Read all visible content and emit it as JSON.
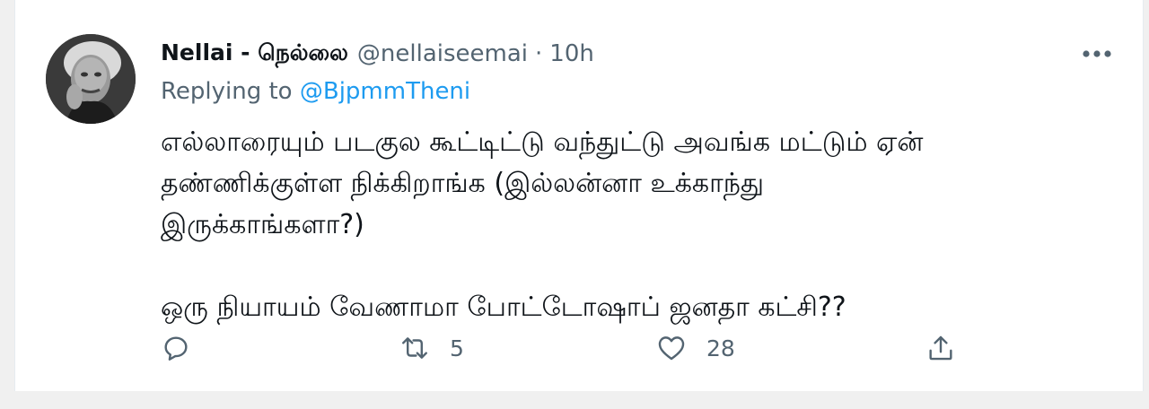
{
  "tweet": {
    "display_name": "Nellai - நெல்லை",
    "handle": "@nellaiseemai",
    "separator": "·",
    "time": "10h",
    "replying_prefix": "Replying to",
    "replying_to": "@BjpmmTheni",
    "text_line_1": "எல்லாரையும் படகுல கூட்டிட்டு வந்துட்டு அவங்க மட்டும் ஏன்",
    "text_line_2": "தண்ணிக்குள்ள நிக்கிறாங்க (இல்லன்னா உக்காந்து",
    "text_line_3": "இருக்காங்களா?)",
    "text_line_4": "ஒரு நியாயம் வேணாமா போட்டோஷாப் ஜனதா கட்சி??",
    "retweet_count": "5",
    "like_count": "28"
  },
  "icons": {
    "avatar": "profile-photo",
    "more": "more-horizontal-icon",
    "reply": "reply-icon",
    "retweet": "retweet-icon",
    "like": "heart-icon",
    "share": "share-icon"
  },
  "colors": {
    "text": "#0f1419",
    "secondary": "#536471",
    "link": "#1d9bf0"
  }
}
